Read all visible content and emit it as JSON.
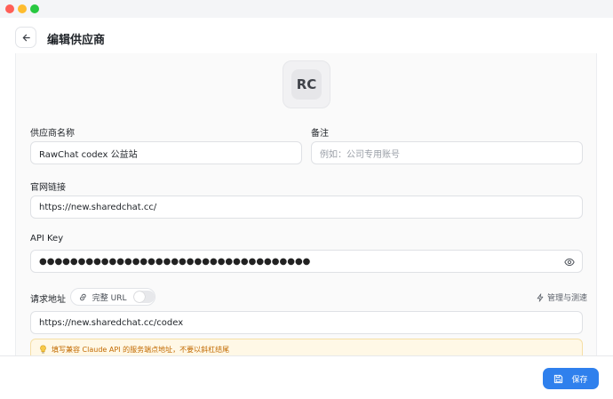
{
  "window": {
    "traffic_lights": [
      "close",
      "minimize",
      "zoom"
    ]
  },
  "header": {
    "title": "编辑供应商",
    "back_icon": "arrow-left-icon"
  },
  "avatar": {
    "initials": "RC"
  },
  "form": {
    "provider_name": {
      "label": "供应商名称",
      "value": "RawChat codex 公益站"
    },
    "notes": {
      "label": "备注",
      "placeholder": "例如：公司专用账号"
    },
    "website": {
      "label": "官网链接",
      "value": "https://new.sharedchat.cc/"
    },
    "api_key": {
      "label": "API Key",
      "masked_value": "●●●●●●●●●●●●●●●●●●●●●●●●●●●●●●●●●●●",
      "toggle_icon": "eye-icon"
    },
    "request_url": {
      "label": "请求地址",
      "full_url_toggle_label": "完整 URL",
      "full_url_enabled": false,
      "manage_label": "管理与测速",
      "value": "https://new.sharedchat.cc/codex"
    },
    "hint": {
      "text": "填写兼容 Claude API 的服务端点地址，不要以斜杠结尾",
      "icon": "lightbulb-icon"
    }
  },
  "footer": {
    "save_label": "保存",
    "save_icon": "save-icon"
  },
  "colors": {
    "accent": "#2f80ed",
    "hint_background": "#fff8e6",
    "hint_text": "#c26a00"
  }
}
